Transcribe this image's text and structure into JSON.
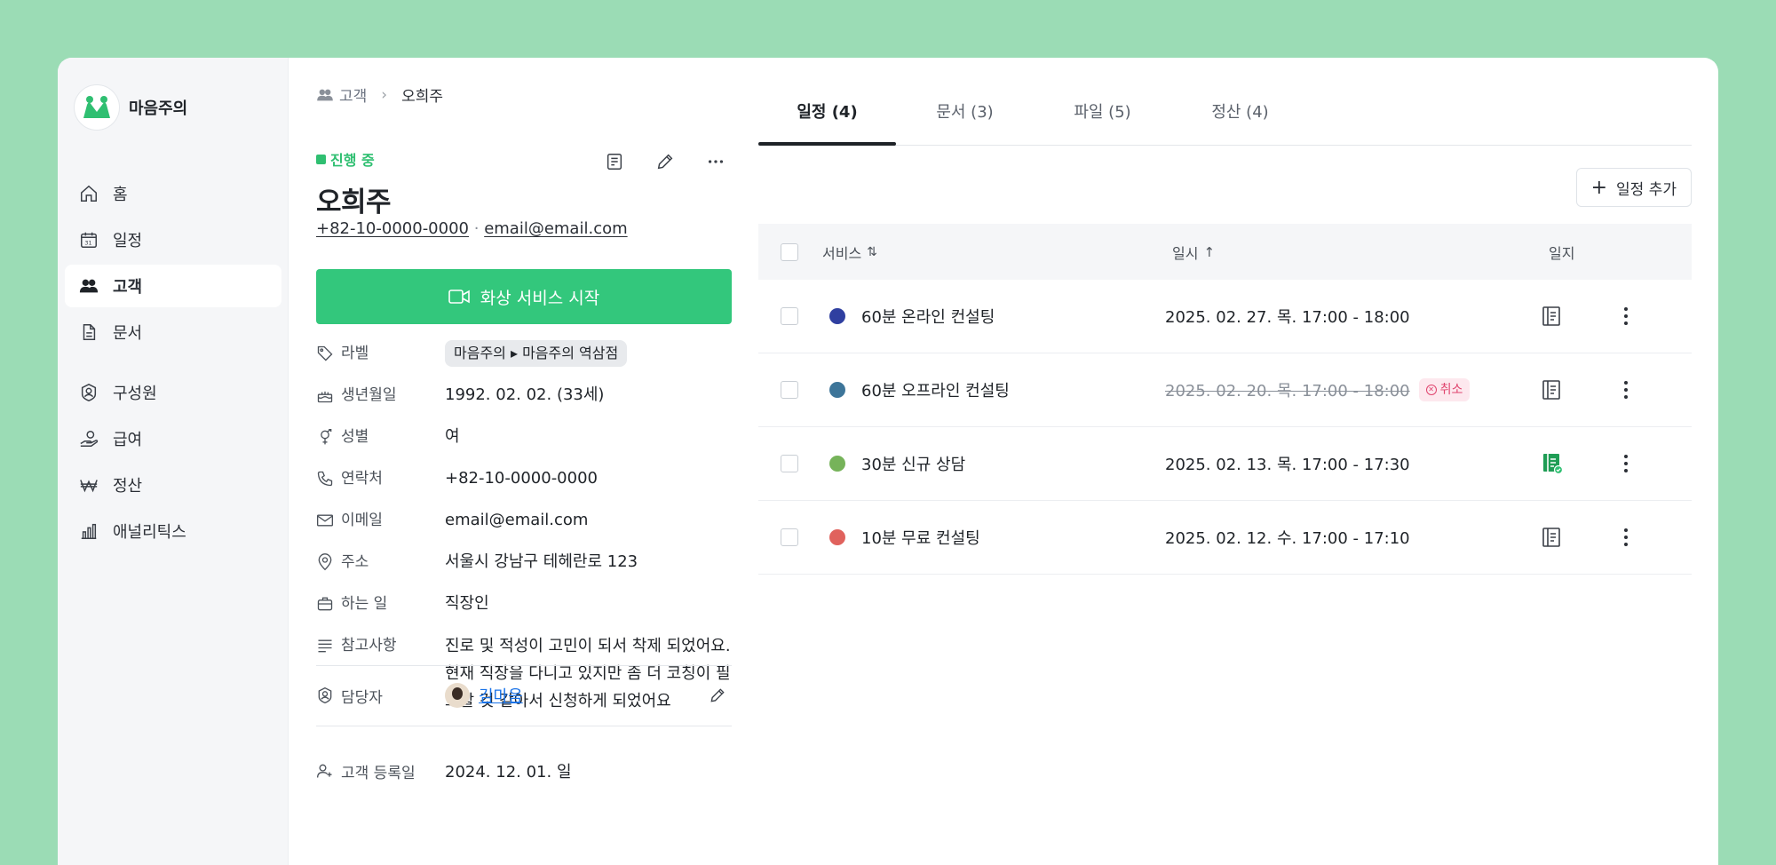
{
  "brand": {
    "name": "마음주의"
  },
  "sidebar": {
    "items": [
      {
        "label": "홈",
        "icon": "home-icon"
      },
      {
        "label": "일정",
        "icon": "calendar-icon"
      },
      {
        "label": "고객",
        "icon": "users-icon",
        "active": true
      },
      {
        "label": "문서",
        "icon": "document-icon"
      },
      {
        "label": "구성원",
        "icon": "member-badge-icon"
      },
      {
        "label": "급여",
        "icon": "salary-hand-icon"
      },
      {
        "label": "정산",
        "icon": "won-icon"
      },
      {
        "label": "애널리틱스",
        "icon": "analytics-icon"
      }
    ]
  },
  "breadcrumb": {
    "parent": "고객",
    "current": "오희주"
  },
  "profile": {
    "status": "진행 중",
    "name": "오희주",
    "phone": "+82-10-0000-0000",
    "email": "email@email.com",
    "video_button": "화상 서비스 시작",
    "fields": [
      {
        "label": "라벨",
        "value": "마음주의 ▸ 마음주의 역삼점",
        "icon": "tag-icon"
      },
      {
        "label": "생년월일",
        "value": "1992. 02. 02. (33세)",
        "icon": "cake-icon"
      },
      {
        "label": "성별",
        "value": "여",
        "icon": "gender-icon"
      },
      {
        "label": "연락처",
        "value": "+82-10-0000-0000",
        "icon": "phone-icon"
      },
      {
        "label": "이메일",
        "value": "email@email.com",
        "icon": "mail-icon"
      },
      {
        "label": "주소",
        "value": "서울시 강남구 테헤란로 123",
        "icon": "location-icon"
      },
      {
        "label": "하는 일",
        "value": "직장인",
        "icon": "briefcase-icon"
      },
      {
        "label": "참고사항",
        "value": "진로 및 적성이 고민이 되서 착제 되었어요. 현재 직장을 다니고 있지만 좀 더 코칭이 필요할 것 같아서 신청하게 되었어요",
        "icon": "notes-icon"
      }
    ],
    "owner_label": "담당자",
    "owner_name": "김마음",
    "registered_label": "고객 등록일",
    "registered_value": "2024. 12. 01. 일"
  },
  "tabs": [
    {
      "label": "일정 (4)",
      "active": true
    },
    {
      "label": "문서 (3)"
    },
    {
      "label": "파일 (5)"
    },
    {
      "label": "정산 (4)"
    }
  ],
  "add_button": "일정 추가",
  "table": {
    "headers": {
      "service": "서비스",
      "datetime": "일시",
      "log": "일지"
    },
    "rows": [
      {
        "service": "60분 온라인 컨설팅",
        "date": "2025. 02. 27. 목. 17:00 - 18:00",
        "color": "#2f3fa0",
        "cancelled": false,
        "log_done": false
      },
      {
        "service": "60분 오프라인 컨설팅",
        "date": "2025. 02. 20. 목. 17:00 - 18:00",
        "color": "#3d7599",
        "cancelled": true,
        "cancel_label": "취소",
        "log_done": false
      },
      {
        "service": "30분 신규 상담",
        "date": "2025. 02. 13. 목. 17:00 - 17:30",
        "color": "#76b35a",
        "cancelled": false,
        "log_done": true
      },
      {
        "service": "10분 무료 컨설팅",
        "date": "2025. 02. 12. 수. 17:00 - 17:10",
        "color": "#e0625d",
        "cancelled": false,
        "log_done": false
      }
    ]
  },
  "colors": {
    "accent": "#33c77c",
    "background": "#9bdcb5",
    "cancel": "#e0446e"
  }
}
